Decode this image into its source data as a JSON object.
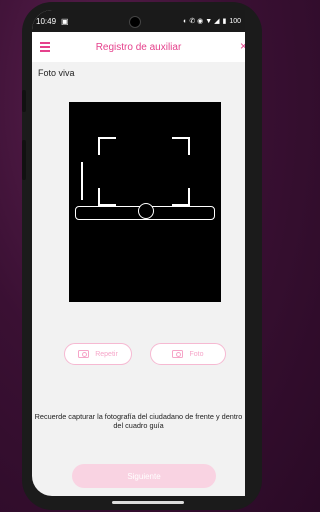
{
  "status_bar": {
    "time": "10:49",
    "right_text": "100"
  },
  "app_bar": {
    "title": "Registro de auxiliar",
    "close_glyph": "×"
  },
  "section_label": "Foto viva",
  "buttons": {
    "repeat_label": "Repetir",
    "photo_label": "Foto"
  },
  "instructions": "Recuerde capturar la fotografía del ciudadano de frente y dentro del cuadro guía",
  "next_button": "Siguiente",
  "colors": {
    "accent": "#e5418c",
    "disabled_accent": "#f6a5c8",
    "next_bg": "#f9d3e2"
  }
}
